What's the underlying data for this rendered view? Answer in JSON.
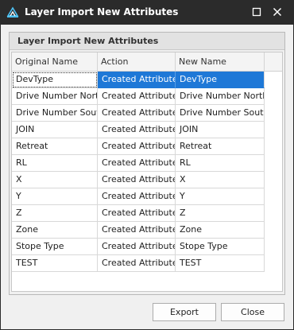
{
  "window": {
    "title": "Layer Import New Attributes"
  },
  "group": {
    "title": "Layer Import New Attributes"
  },
  "grid": {
    "columns": [
      "Original Name",
      "Action",
      "New Name"
    ],
    "rows": [
      [
        "DevType",
        "Created Attribute",
        "DevType"
      ],
      [
        "Drive Number North",
        "Created Attribute",
        "Drive Number North"
      ],
      [
        "Drive Number South",
        "Created Attribute",
        "Drive Number South"
      ],
      [
        "JOIN",
        "Created Attribute",
        "JOIN"
      ],
      [
        "Retreat",
        "Created Attribute",
        "Retreat"
      ],
      [
        "RL",
        "Created Attribute",
        "RL"
      ],
      [
        "X",
        "Created Attribute",
        "X"
      ],
      [
        "Y",
        "Created Attribute",
        "Y"
      ],
      [
        "Z",
        "Created Attribute",
        "Z"
      ],
      [
        "Zone",
        "Created Attribute",
        "Zone"
      ],
      [
        "Stope Type",
        "Created Attribute",
        "Stope Type"
      ],
      [
        "TEST",
        "Created Attribute",
        "TEST"
      ]
    ],
    "selected_row": 0
  },
  "buttons": {
    "export_label": "Export",
    "close_label": "Close"
  },
  "icons": {
    "app": "app-layers-icon",
    "maximize": "maximize-icon",
    "close": "close-icon"
  },
  "colors": {
    "titlebar": "#2b2b2b",
    "selection": "#1e78d7"
  }
}
